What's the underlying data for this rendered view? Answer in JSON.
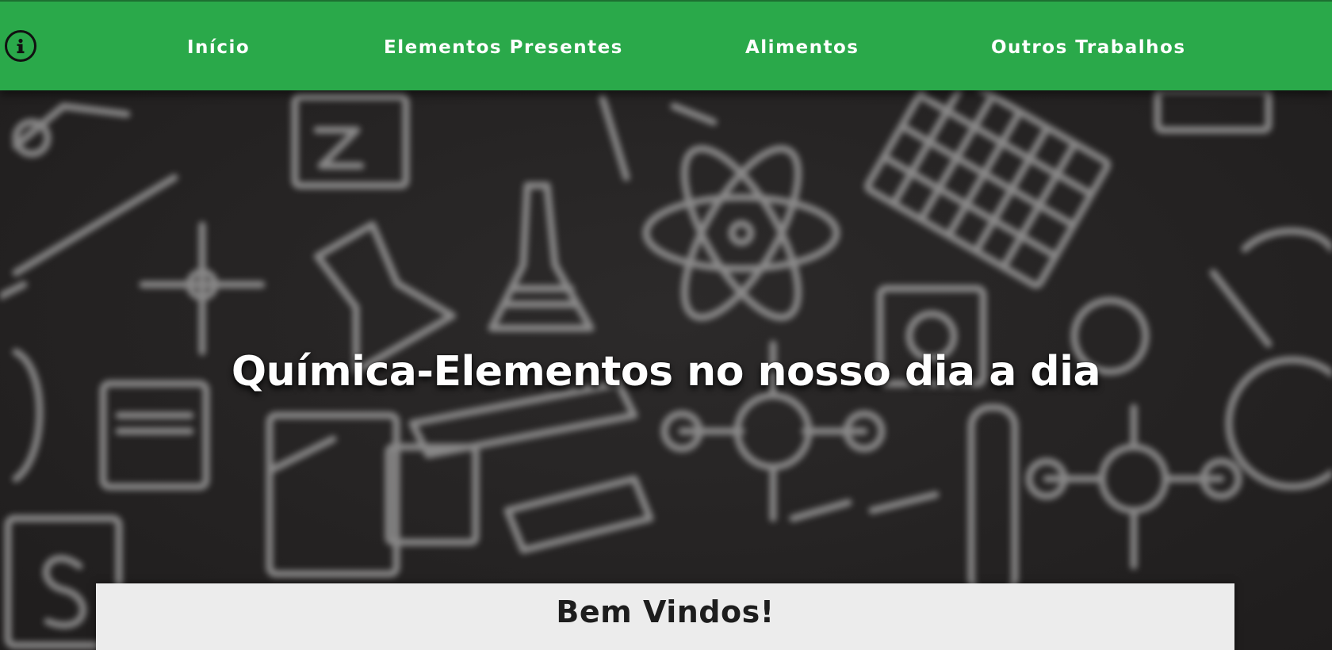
{
  "nav": {
    "info_icon": "info-circle-icon",
    "items": [
      {
        "label": "Início"
      },
      {
        "label": "Elementos Presentes"
      },
      {
        "label": "Alimentos"
      },
      {
        "label": "Outros Trabalhos"
      }
    ]
  },
  "hero": {
    "title": "Química-Elementos no nosso dia a dia",
    "background": "chemistry-doodles-chalkboard"
  },
  "welcome": {
    "title": "Bem Vindos!"
  },
  "colors": {
    "navbar": "#2aa94a",
    "hero_bg": "#232222",
    "card_bg": "#ececec"
  }
}
